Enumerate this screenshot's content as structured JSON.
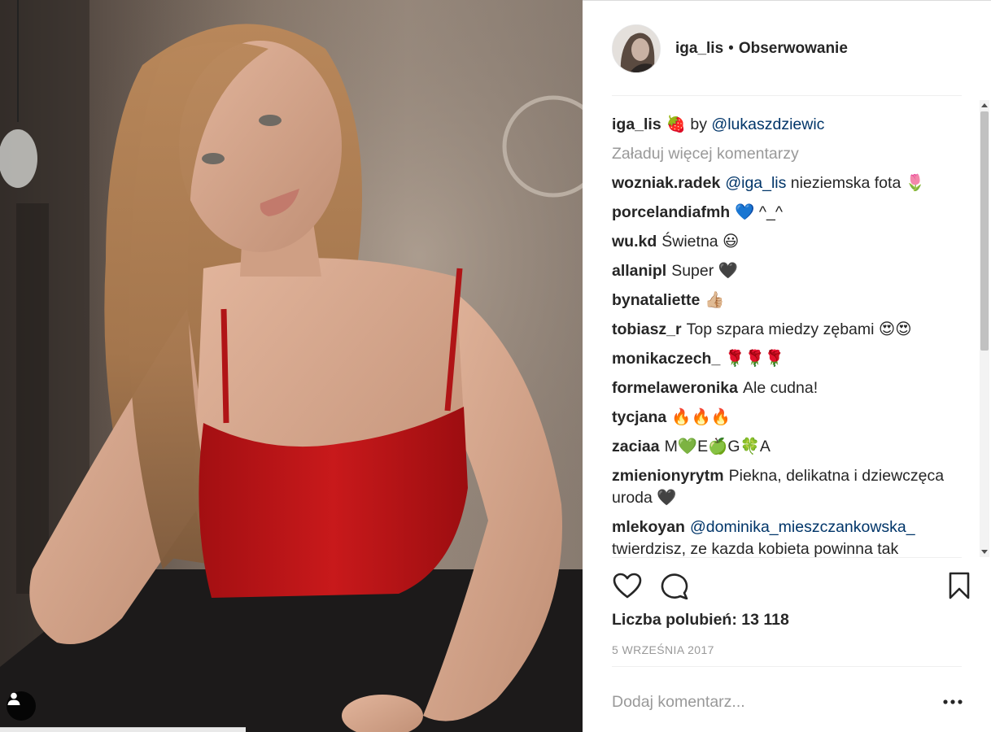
{
  "post": {
    "username": "iga_lis",
    "separator": "•",
    "follow_label": "Obserwowanie",
    "caption": {
      "user": "iga_lis",
      "emoji": "🍓",
      "text": " by ",
      "mention": "@lukaszdziewic"
    },
    "load_more_label": "Załaduj więcej komentarzy",
    "comments": [
      {
        "user": "wozniak.radek",
        "mention": "@iga_lis",
        "text": " nieziemska fota 🌷"
      },
      {
        "user": "porcelandiafmh",
        "mention": "",
        "text": "💙 ^_^"
      },
      {
        "user": "wu.kd",
        "mention": "",
        "text": "Świetna 😃"
      },
      {
        "user": "allanipl",
        "mention": "",
        "text": "Super 🖤"
      },
      {
        "user": "bynataliette",
        "mention": "",
        "text": "👍🏼"
      },
      {
        "user": "tobiasz_r",
        "mention": "",
        "text": "Top szpara miedzy zębami 😍😍"
      },
      {
        "user": "monikaczech_",
        "mention": "",
        "text": "🌹🌹🌹"
      },
      {
        "user": "formelaweronika",
        "mention": "",
        "text": "Ale cudna!"
      },
      {
        "user": "tycjana",
        "mention": "",
        "text": "🔥🔥🔥"
      },
      {
        "user": "zaciaa",
        "mention": "",
        "text": "M💚E🍏G🍀A"
      },
      {
        "user": "zmienionyrytm",
        "mention": "",
        "text": "Piekna, delikatna i dziewczęca uroda 🖤"
      },
      {
        "user": "mlekoyan",
        "mention": "@dominika_mieszczankowska_",
        "text": " twierdzisz, ze kazda kobieta powinna tak"
      }
    ],
    "likes_label": "Liczba polubień: 13 118",
    "date_label": "5 WRZEŚNIA 2017",
    "add_comment_placeholder": "Dodaj komentarz...",
    "more_label": "•••"
  },
  "icons": {
    "like": "heart-icon",
    "comment": "comment-bubble-icon",
    "save": "bookmark-icon",
    "more": "more-options-icon",
    "user_tag": "user-tag-icon"
  },
  "colors": {
    "text": "#262626",
    "link": "#003569",
    "muted": "#999999",
    "divider": "#efefef"
  }
}
